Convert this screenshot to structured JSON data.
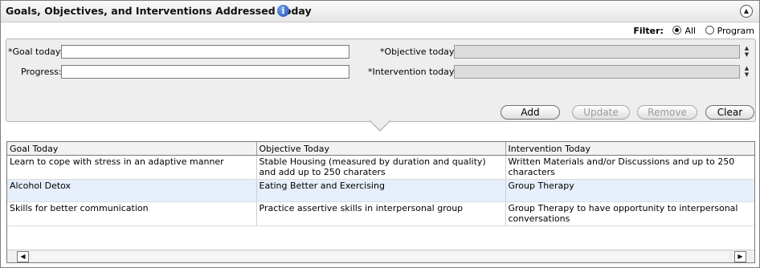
{
  "header": {
    "title": "Goals, Objectives, and Interventions Addressed Today",
    "info_icon": "i"
  },
  "filter": {
    "label": "Filter:",
    "options": [
      {
        "label": "All",
        "selected": true
      },
      {
        "label": "Program",
        "selected": false
      }
    ]
  },
  "form": {
    "goal_label": "*Goal today:",
    "goal_value": "",
    "progress_label": "Progress:",
    "progress_value": "",
    "objective_label": "*Objective today:",
    "objective_value": "",
    "intervention_label": "*Intervention today:",
    "intervention_value": ""
  },
  "buttons": {
    "add": "Add",
    "update": "Update",
    "remove": "Remove",
    "clear": "Clear"
  },
  "table": {
    "columns": [
      "Goal Today",
      "Objective Today",
      "Intervention Today"
    ],
    "rows": [
      [
        "Learn to cope with stress in an adaptive manner",
        "Stable Housing (measured by duration and quality) and add up to 250 charaters",
        "Written Materials and/or Discussions and up to 250 characters"
      ],
      [
        "Alcohol Detox",
        "Eating Better and Exercising",
        "Group Therapy"
      ],
      [
        "Skills for better communication",
        "Practice assertive skills in interpersonal group",
        "Group Therapy to have opportunity to interpersonal conversations"
      ]
    ]
  }
}
